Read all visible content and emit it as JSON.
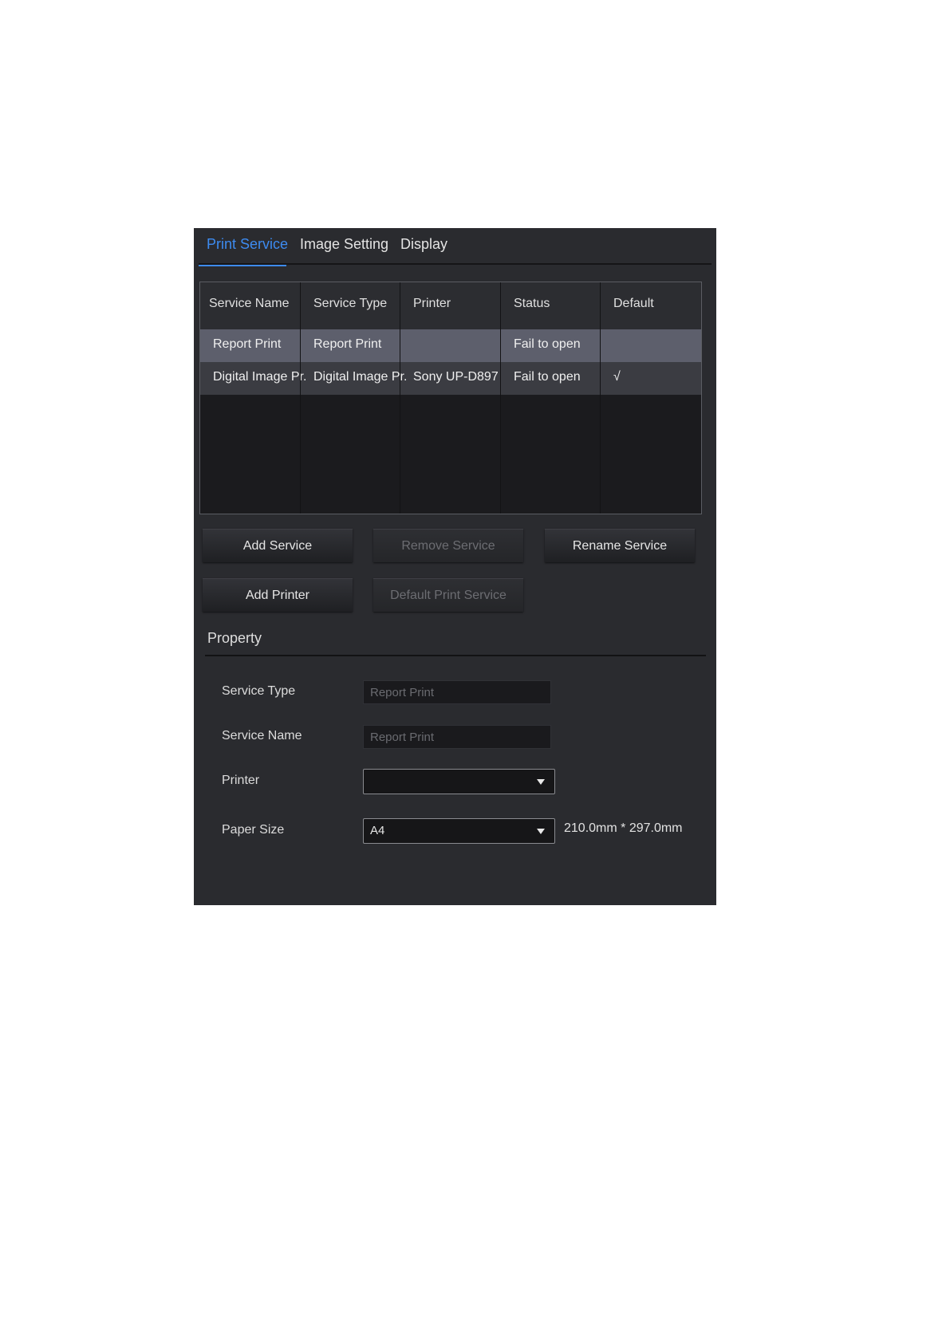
{
  "tabs": [
    {
      "label": "Print Service",
      "active": true
    },
    {
      "label": "Image Setting",
      "active": false
    },
    {
      "label": "Display",
      "active": false
    }
  ],
  "table": {
    "headers": [
      "Service Name",
      "Service Type",
      "Printer",
      "Status",
      "Default"
    ],
    "rows": [
      {
        "service_name": "Report Print",
        "service_type": "Report Print",
        "printer": "",
        "status": "Fail to open",
        "default": "",
        "selected": true
      },
      {
        "service_name": "Digital Image Pr...",
        "service_type": "Digital Image Pr...",
        "printer": "Sony UP-D897",
        "status": "Fail to open",
        "default": "√",
        "selected": false
      }
    ]
  },
  "buttons": {
    "add_service": "Add Service",
    "remove_service": "Remove Service",
    "rename_service": "Rename Service",
    "add_printer": "Add Printer",
    "default_print_service": "Default Print Service"
  },
  "property": {
    "title": "Property",
    "service_type_label": "Service Type",
    "service_type_value": "Report Print",
    "service_name_label": "Service Name",
    "service_name_value": "Report Print",
    "printer_label": "Printer",
    "printer_value": "",
    "paper_size_label": "Paper Size",
    "paper_size_value": "A4",
    "paper_dimensions": "210.0mm * 297.0mm"
  },
  "colors": {
    "panel_bg": "#2a2b2f",
    "accent": "#3d8bf0",
    "selected_row": "#5d5f6c"
  },
  "icons": [
    "dropdown-caret-icon"
  ]
}
